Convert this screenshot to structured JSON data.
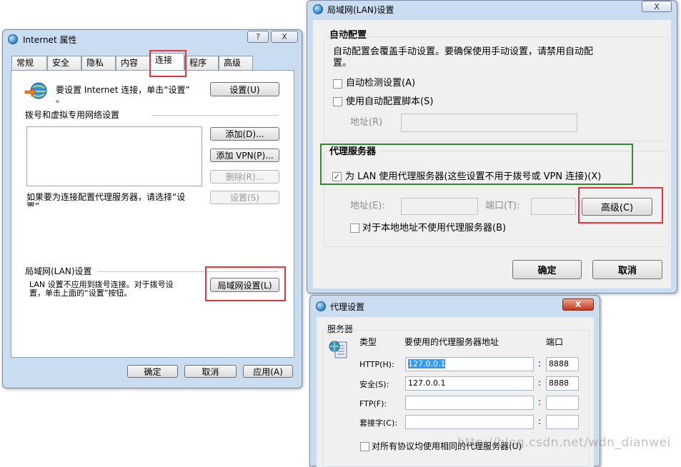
{
  "inet_window": {
    "title": "Internet 属性",
    "help_label": "?",
    "close_label": "X",
    "tabs": [
      "常规",
      "安全",
      "隐私",
      "内容",
      "连接",
      "程序",
      "高级"
    ],
    "active_tab": "连接",
    "setup_text_line1": "要设置 Internet 连接，单击“设置”",
    "setup_text_line2": "。",
    "setup_button": "设置(U)",
    "dialup_heading": "拨号和虚拟专用网络设置",
    "add_button": "添加(D)...",
    "add_vpn_button": "添加 VPN(P)...",
    "delete_button": "删除(R)...",
    "settings_button": "设置(S)",
    "proxy_hint": "如果要为连接配置代理服务器，请选择“设",
    "proxy_hint_cont": "置”。",
    "lan_heading": "局域网(LAN)设置",
    "lan_desc_line1": "LAN 设置不应用到拨号连接。对于拨号设",
    "lan_desc_line2": "置，单击上面的“设置”按钮。",
    "lan_button": "局域网设置(L)",
    "ok_button": "确定",
    "cancel_button": "取消",
    "apply_button": "应用(A)"
  },
  "lan_window": {
    "title": "局域网(LAN)设置",
    "close_label": "X",
    "auto_heading": "自动配置",
    "auto_desc_line1": "自动配置会覆盖手动设置。要确保使用手动设置，请禁用自动配",
    "auto_desc_line2": "置。",
    "auto_detect_label": "自动检测设置(A)",
    "auto_detect_checked": false,
    "auto_script_label": "使用自动配置脚本(S)",
    "auto_script_checked": false,
    "script_address_label": "地址(R)",
    "proxy_heading": "代理服务器",
    "use_proxy_label": "为 LAN 使用代理服务器(这些设置不用于拨号或 VPN 连接)(X)",
    "use_proxy_checked": true,
    "check_mark": "✓",
    "address_label": "地址(E):",
    "port_label": "端口(T):",
    "advanced_button": "高级(C)",
    "bypass_local_label": "对于本地地址不使用代理服务器(B)",
    "bypass_local_checked": false,
    "ok_button": "确定",
    "cancel_button": "取消"
  },
  "proxy_window": {
    "title": "代理设置",
    "close_label": "X",
    "servers_heading": "服务器",
    "col_type": "类型",
    "col_address": "要使用的代理服务器地址",
    "col_port": "端口",
    "colon": ":",
    "rows": [
      {
        "type": "HTTP(H):",
        "address": "127.0.0.1",
        "port": "8888"
      },
      {
        "type": "安全(S):",
        "address": "127.0.0.1",
        "port": "8888"
      },
      {
        "type": "FTP(F):",
        "address": "",
        "port": ""
      },
      {
        "type": "套接字(C):",
        "address": "",
        "port": ""
      }
    ],
    "same_proxy_label": "对所有协议均使用相同的代理服务器(U)",
    "same_proxy_checked": false
  },
  "watermark": "http://blog.csdn.net/wdn_dianwei",
  "colors": {
    "highlight_red": "#e8333a",
    "highlight_green": "#2f8a2f",
    "selection_blue": "#3399ff"
  }
}
